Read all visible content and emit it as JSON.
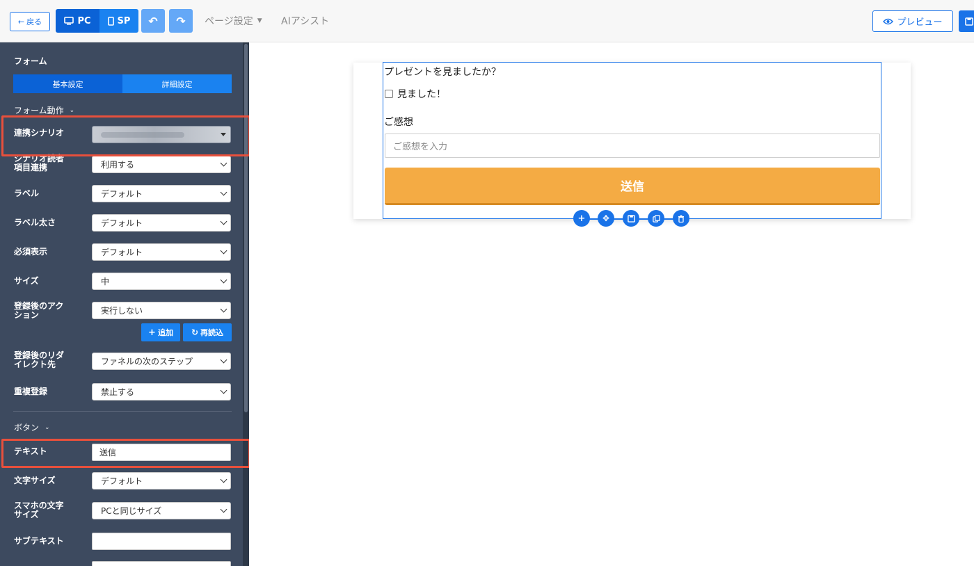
{
  "toolbar": {
    "back_label": "戻る",
    "pc_label": "PC",
    "sp_label": "SP",
    "page_settings_label": "ページ設定",
    "ai_assist_label": "AIアシスト",
    "preview_label": "プレビュー"
  },
  "sidebar": {
    "form_title": "フォーム",
    "tabs": {
      "basic": "基本設定",
      "detail": "詳細設定"
    },
    "form_action_heading": "フォーム動作",
    "rows": {
      "scenario": {
        "label": "連携シナリオ",
        "value": ""
      },
      "reader_link": {
        "label": "シナリオ読者\n項目連携",
        "value": "利用する"
      },
      "label_setting": {
        "label": "ラベル",
        "value": "デフォルト"
      },
      "label_bold": {
        "label": "ラベル太さ",
        "value": "デフォルト"
      },
      "required": {
        "label": "必須表示",
        "value": "デフォルト"
      },
      "size": {
        "label": "サイズ",
        "value": "中"
      },
      "post_action": {
        "label": "登録後のアク\nション",
        "value": "実行しない"
      },
      "redirect": {
        "label": "登録後のリダ\nイレクト先",
        "value": "ファネルの次のステップ"
      },
      "duplicate": {
        "label": "重複登録",
        "value": "禁止する"
      }
    },
    "add_button": "追加",
    "reload_button": "再読込",
    "button_heading": "ボタン",
    "button_rows": {
      "text": {
        "label": "テキスト",
        "value": "送信"
      },
      "font_size": {
        "label": "文字サイズ",
        "value": "デフォルト"
      },
      "sp_font_size": {
        "label": "スマホの文字\nサイズ",
        "value": "PCと同じサイズ"
      },
      "subtext": {
        "label": "サブテキスト",
        "value": ""
      }
    }
  },
  "canvas": {
    "question": "プレゼントを見ましたか？",
    "checkbox_label": "見ました！",
    "impression_label": "ご感想",
    "impression_placeholder": "ご感想を入力",
    "submit_label": "送信"
  },
  "colors": {
    "primary": "#1a73e8",
    "sidebar_bg": "#3d4a5f",
    "submit_bg": "#f4ab44",
    "highlight": "#e8503c"
  }
}
